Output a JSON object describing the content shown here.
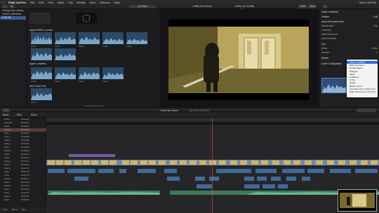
{
  "menubar": {
    "items": [
      "Final Cut Pro",
      "File",
      "Edit",
      "Trim",
      "Mark",
      "Clip",
      "Modify",
      "View",
      "Window",
      "Help"
    ],
    "right": [
      "Mon 4:38 PM"
    ]
  },
  "toolbar": {
    "hide_label": "Hide Rejected",
    "browser_filter": "All Clips",
    "viewer_title": "Coffee Bar Scene",
    "viewer_res": "1080p HD 23.98p Stereo",
    "zoom": "100%",
    "view_btn": "View"
  },
  "library": {
    "items": [
      "Holiday Day Library",
      "Smart Collections",
      "6-30-18"
    ]
  },
  "browser": {
    "sections": [
      "Apple MPEG-4 audio",
      "Apple Lossless",
      "AAC Audio File"
    ],
    "groups": [
      {
        "labels": [
          "Audio",
          "Audio",
          "Audio",
          "Audio",
          "Audio"
        ]
      },
      {
        "labels": [
          "Audio",
          "Audio",
          "Audio",
          "Audio"
        ]
      },
      {
        "labels": [
          "Audio"
        ]
      }
    ],
    "status": "1 of 18 selected, 01:30"
  },
  "viewer": {
    "timecode": "00:04:12",
    "footer_left": "01:30 / 03:12:00"
  },
  "inspector": {
    "title": "Audio Inspector",
    "rows": [
      [
        "Volume",
        "0 dB"
      ],
      [
        "Audio Enhancements",
        ""
      ],
      [
        "Equalization",
        "Flat"
      ],
      [
        "Loudness",
        ""
      ],
      [
        "Noise Removal",
        ""
      ],
      [
        "Hum Removal",
        ""
      ],
      [
        "Pan",
        ""
      ],
      [
        "Mode",
        "None"
      ],
      [
        "Amount",
        "0"
      ],
      [
        "Effects",
        ""
      ],
      [
        "Audio Configuration",
        ""
      ]
    ],
    "popup": {
      "items": [
        "Stereo Left/Right",
        "Basic Surround",
        "Create Space",
        "Dialogue",
        "Music",
        "Ambience",
        "Circle",
        "Rotate",
        "Back to Front",
        "Left Surround to Right Front",
        "Right Surround to Left Front"
      ],
      "selected_index": 0
    }
  },
  "timeline": {
    "header_title": "Coffee Bar Scene",
    "header_time": "03:12:00 / 07:09:12",
    "roles_header": [
      "Name",
      "Role",
      "Notes"
    ],
    "roles": [
      {
        "name": "Dialog",
        "time": "00:00:00"
      },
      {
        "name": "Dialogue",
        "time": "00:00:01"
      },
      {
        "name": "Music",
        "time": "00:00:02"
      },
      {
        "name": "Effects",
        "time": "00:00:03"
      },
      {
        "name": "Video",
        "time": "00:00:04"
      },
      {
        "name": "Titles",
        "time": "00:00:05"
      },
      {
        "name": "Dialog",
        "time": "00:00:06"
      },
      {
        "name": "Dialog",
        "time": "00:00:07"
      },
      {
        "name": "Music",
        "time": "00:00:08"
      },
      {
        "name": "Effects",
        "time": "00:00:09"
      },
      {
        "name": "Video",
        "time": "00:00:10"
      },
      {
        "name": "Titles",
        "time": "00:00:11"
      },
      {
        "name": "Dialog",
        "time": "00:00:12"
      },
      {
        "name": "Music",
        "time": "00:00:13"
      },
      {
        "name": "Effects",
        "time": "00:00:14"
      },
      {
        "name": "Video",
        "time": "00:00:15"
      },
      {
        "name": "Titles",
        "time": "00:00:16"
      },
      {
        "name": "Dialog",
        "time": "00:00:17"
      },
      {
        "name": "Music",
        "time": "00:00:18"
      },
      {
        "name": "Effects",
        "time": "00:00:19"
      },
      {
        "name": "Video",
        "time": "00:00:20"
      },
      {
        "name": "Titles",
        "time": "00:00:21"
      },
      {
        "name": "Dialog",
        "time": "00:00:22"
      },
      {
        "name": "Music",
        "time": "00:00:23"
      }
    ],
    "roles_footer": [
      "Clips",
      "Roles",
      "Tags"
    ]
  },
  "colors": {
    "accent": "#3b5c8f",
    "video_clip": "#6b88a8",
    "audio_clip": "#3d7a5a",
    "title_clip": "#7a5aa8",
    "popup_sel": "#2e6bd6"
  }
}
